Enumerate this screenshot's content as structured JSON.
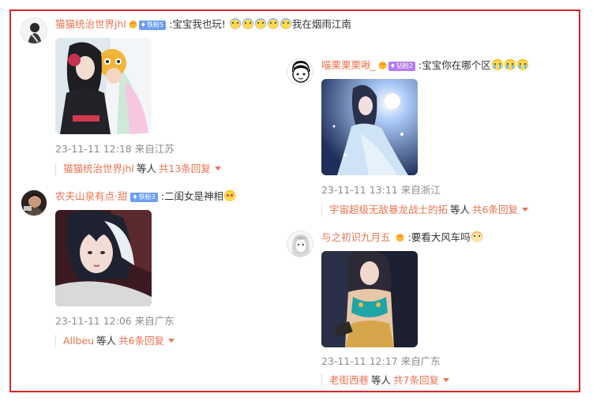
{
  "colors": {
    "frame": "#d9262c",
    "username": "#eb7350",
    "meta": "#8c8c8c",
    "badge_blue": "#6b9ef4",
    "badge_purple": "#b57cf2"
  },
  "comments": [
    {
      "user": "猫猫统治世界jhl",
      "badge": "铁粉5",
      "badge_color": "#6b9ef4",
      "text_before": ":宝宝我也玩!",
      "emojis": [
        "hold-emoji",
        "hold-emoji",
        "hold-emoji",
        "hold-emoji",
        "hold-emoji"
      ],
      "text_after": "我在烟雨江南",
      "meta": "23-11-11 12:18 来自江苏",
      "reply_user": "猫猫统治世界jhl",
      "reply_etc": "等人",
      "reply_count": "共13条回复"
    },
    {
      "user": "喵栗栗栗啾_",
      "badge": "钻粉2",
      "badge_color": "#b57cf2",
      "text_before": ":宝宝你在哪个区",
      "emojis": [
        "cry-emoji",
        "cry-emoji",
        "cry-emoji"
      ],
      "text_after": "",
      "meta": "23-11-11 13:11 来自浙江",
      "reply_user": "宇宙超级无敌暴龙战士的拓",
      "reply_etc": "等人",
      "reply_count": "共6条回复"
    },
    {
      "user": "农夫山泉有点·甜",
      "badge": "铁粉3",
      "badge_color": "#6b9ef4",
      "text_before": ":二闺女是神相",
      "emojis": [
        "love-emoji"
      ],
      "text_after": "",
      "meta": "23-11-11 12:06 来自广东",
      "reply_user": "Allbeu",
      "reply_etc": "等人",
      "reply_count": "共6条回复"
    },
    {
      "user": "与之初识九月五",
      "badge": "",
      "badge_color": "",
      "text_before": ":要看大风车吗",
      "emojis": [
        "cat-emoji"
      ],
      "text_after": "",
      "meta": "23-11-11 12:17 来自广东",
      "reply_user": "老街西巷",
      "reply_etc": "等人",
      "reply_count": "共7条回复"
    }
  ]
}
